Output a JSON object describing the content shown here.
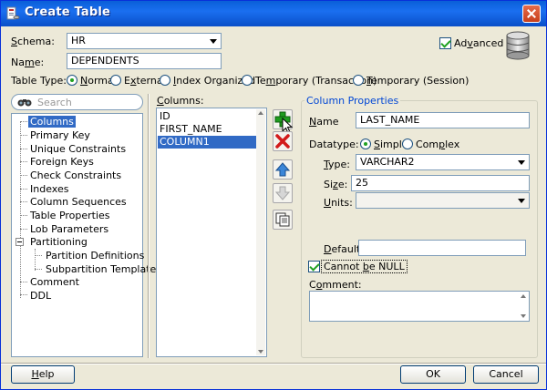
{
  "window": {
    "title": "Create Table"
  },
  "schema": {
    "label_u": "S",
    "label_rest": "chema:",
    "value": "HR"
  },
  "name": {
    "label_pre": "Na",
    "label_u": "m",
    "label_post": "e:",
    "value": "DEPENDENTS"
  },
  "advanced": {
    "label_pre": "Ad",
    "label_u": "v",
    "label_post": "anced",
    "checked": true
  },
  "table_type": {
    "label": "Table Type:",
    "options": [
      {
        "u": "N",
        "rest": "ormal",
        "selected": true
      },
      {
        "pre": "E",
        "u": "x",
        "rest": "ternal",
        "selected": false
      },
      {
        "u": "I",
        "rest": "ndex Organized",
        "selected": false
      },
      {
        "pre": "Te",
        "u": "m",
        "rest": "porary (Transaction)",
        "selected": false
      },
      {
        "u": "T",
        "rest": "emporary (Session)",
        "selected": false
      }
    ]
  },
  "search": {
    "placeholder": "Search"
  },
  "nav_tree": {
    "items": [
      "Columns",
      "Primary Key",
      "Unique Constraints",
      "Foreign Keys",
      "Check Constraints",
      "Indexes",
      "Column Sequences",
      "Table Properties",
      "Lob Parameters",
      "Partitioning",
      "Partition Definitions",
      "Subpartition Templates",
      "Comment",
      "DDL"
    ],
    "selected": "Columns"
  },
  "columns": {
    "label_u": "C",
    "label_rest": "olumns:",
    "items": [
      "ID",
      "FIRST_NAME",
      "COLUMN1"
    ],
    "selected": "COLUMN1"
  },
  "column_properties": {
    "title": "Column Properties",
    "name_label_u": "N",
    "name_label_rest": "ame",
    "name_value": "LAST_NAME",
    "datatype_label": "Datatype:",
    "simple_u": "S",
    "simple_rest": "imple",
    "complex_pre": "Com",
    "complex_u": "p",
    "complex_rest": "lex",
    "type_label_u": "T",
    "type_label_rest": "ype:",
    "type_value": "VARCHAR2",
    "size_label_pre": "Si",
    "size_label_u": "z",
    "size_label_post": "e:",
    "size_value": "25",
    "units_label_u": "U",
    "units_label_rest": "nits:",
    "units_value": "",
    "default_label_pre": "",
    "default_label_u": "D",
    "default_label_rest": "efault:",
    "default_value": "",
    "not_null_pre": "Cannot ",
    "not_null_u": "b",
    "not_null_rest": "e NULL",
    "not_null_checked": true,
    "comment_label_pre": "C",
    "comment_label_u": "o",
    "comment_label_rest": "mment:",
    "comment_value": ""
  },
  "buttons": {
    "help_u": "H",
    "help_rest": "elp",
    "ok": "OK",
    "cancel": "Cancel"
  },
  "colors": {
    "accent": "#316ac5",
    "titlebar": "#0a5fd8",
    "group_title": "#0046d5"
  }
}
